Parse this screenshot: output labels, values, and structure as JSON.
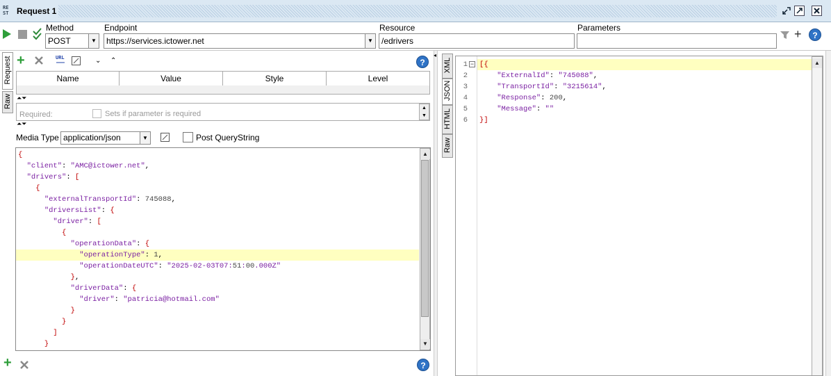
{
  "title": {
    "icon_text": "RE ST",
    "label": "Request 1"
  },
  "toolbar": {
    "method_label": "Method",
    "method_value": "POST",
    "endpoint_label": "Endpoint",
    "endpoint_value": "https://services.ictower.net",
    "resource_label": "Resource",
    "resource_value": "/edrivers",
    "parameters_label": "Parameters",
    "parameters_value": ""
  },
  "left_tabs": [
    "Request",
    "Raw"
  ],
  "param_table": {
    "headers": [
      "Name",
      "Value",
      "Style",
      "Level"
    ]
  },
  "required": {
    "label": "Required:",
    "checkbox_label": "Sets if parameter is required"
  },
  "media": {
    "label": "Media Type",
    "value": "application/json",
    "post_qs_label": "Post QueryString"
  },
  "request_body": [
    "{",
    "  \"client\": \"AMC@ictower.net\",",
    "  \"drivers\": [",
    "    {",
    "      \"externalTransportId\": 745088,",
    "      \"driversList\": {",
    "        \"driver\": [",
    "          {",
    "            \"operationData\": {",
    "              \"operationType\": 1,",
    "              \"operationDateUTC\": \"2025-02-03T07:51:00.000Z\"",
    "            },",
    "            \"driverData\": {",
    "              \"driver\": \"patricia@hotmail.com\"",
    "            }",
    "          }",
    "        ]",
    "      }"
  ],
  "right_tabs": [
    "XML",
    "JSON",
    "HTML",
    "Raw"
  ],
  "response": {
    "line_numbers": [
      "1",
      "2",
      "3",
      "4",
      "5",
      "6"
    ],
    "lines": [
      "[{",
      "    \"ExternalId\": \"745088\",",
      "    \"TransportId\": \"3215614\",",
      "    \"Response\": 200,",
      "    \"Message\": \"\"",
      "}]"
    ]
  },
  "colors": {
    "accent": "#2f73c6",
    "highlight": "#ffffc0",
    "json_key": "#7a1fa2",
    "bracket": "#c00000",
    "add_green": "#2e9e3a"
  }
}
